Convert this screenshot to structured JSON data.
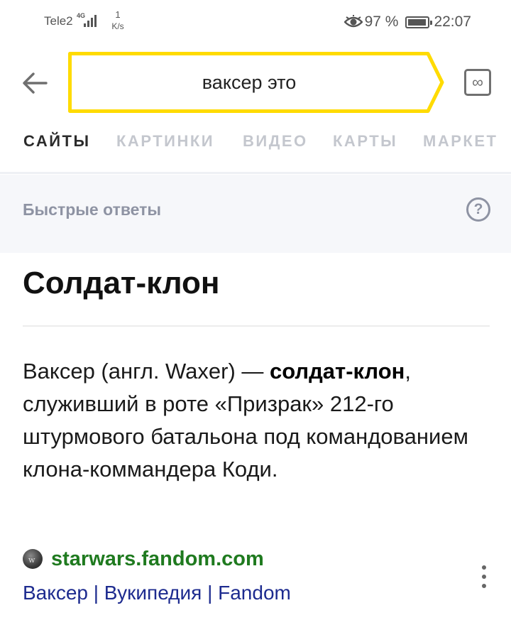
{
  "status_bar": {
    "carrier": "Tele2",
    "network": "4G",
    "speed_value": "1",
    "speed_unit": "K/s",
    "battery": "97 %",
    "time": "22:07",
    "icons": [
      "signal-bars-icon",
      "eye-icon",
      "battery-icon"
    ]
  },
  "search": {
    "query": "ваксер это",
    "accent_color": "#FFDB00",
    "back_icon": "arrow-left-icon",
    "incognito_icon": "infinity-icon",
    "incognito_symbol": "∞"
  },
  "tabs": [
    {
      "label": "САЙТЫ",
      "active": true
    },
    {
      "label": "КАРТИНКИ",
      "active": false
    },
    {
      "label": "ВИДЕО",
      "active": false
    },
    {
      "label": "КАРТЫ",
      "active": false
    },
    {
      "label": "МАРКЕТ",
      "active": false
    }
  ],
  "quick_answers": {
    "header": "Быстрые ответы",
    "help_icon": "question-circle-icon",
    "help_symbol": "?",
    "title": "Солдат-клон",
    "text_before": "Ваксер (англ. Waxer) — ",
    "text_bold": "солдат-клон",
    "text_after": ", служивший в роте «Призрак» 212-го штурмового батальона под командованием клона-коммандера Коди.",
    "source_domain": "starwars.fandom.com",
    "source_link": "Ваксер | Вукипедия | Fandom",
    "domain_color": "#1F7A1F",
    "link_color": "#1D2B8F"
  }
}
